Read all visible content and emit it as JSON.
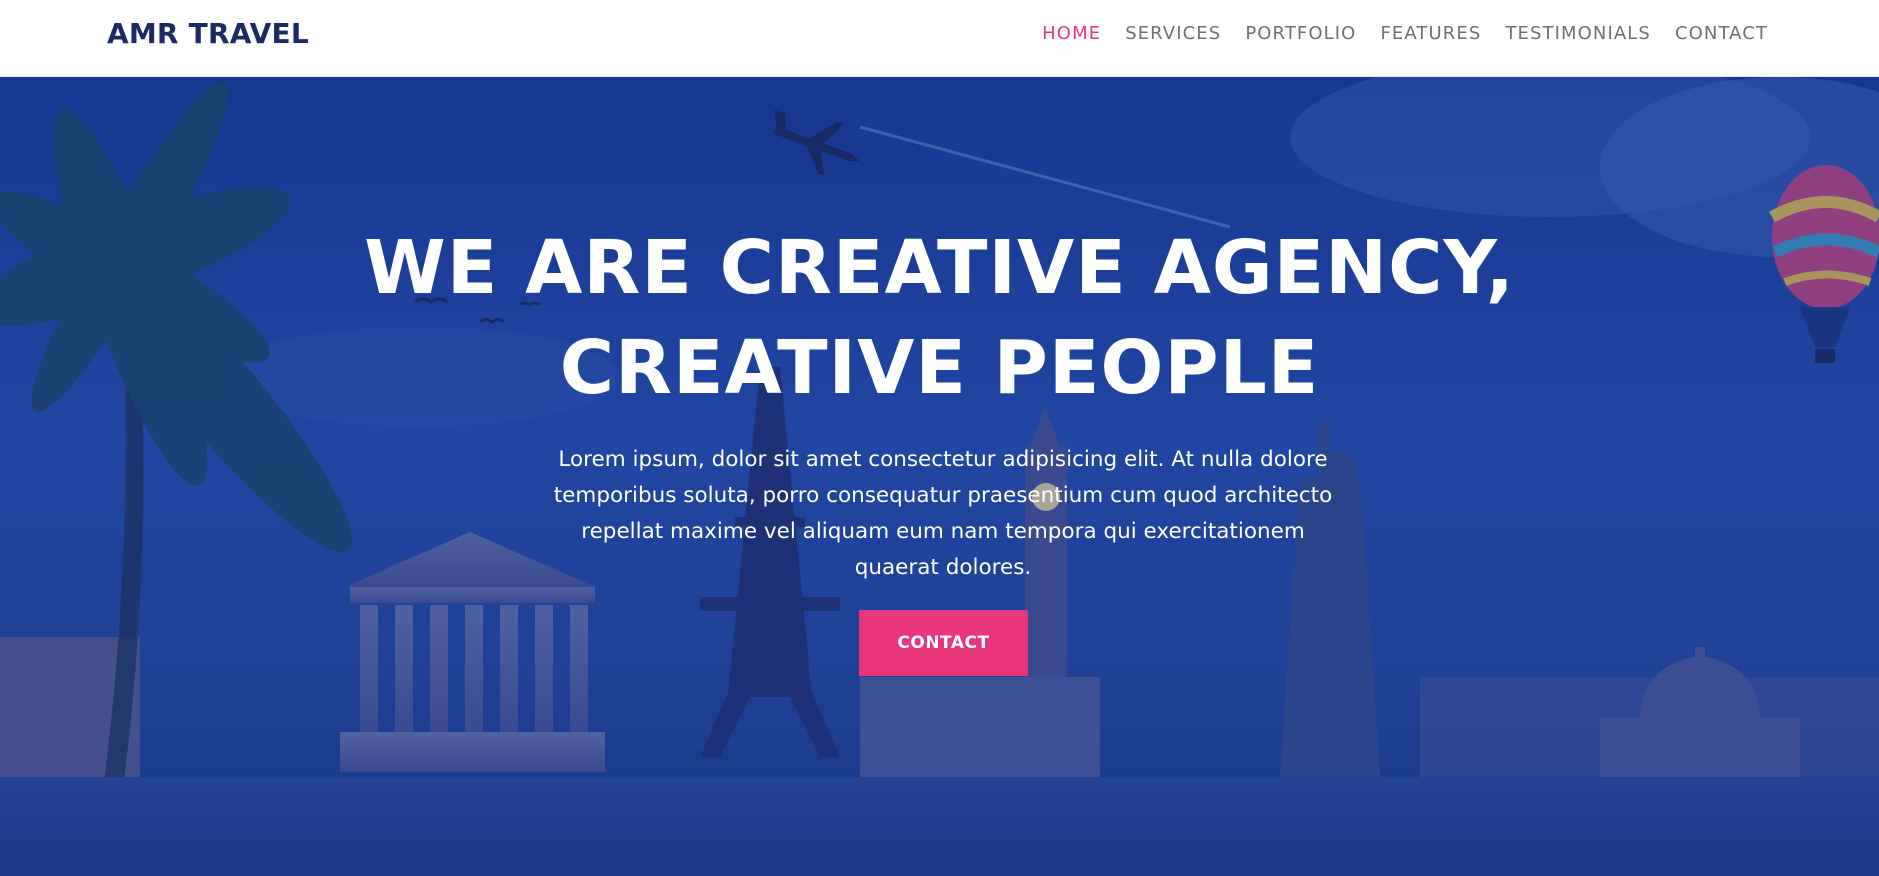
{
  "navbar": {
    "brand": "AMR TRAVEL",
    "links": [
      {
        "label": "HOME",
        "active": true
      },
      {
        "label": "SERVICES",
        "active": false
      },
      {
        "label": "PORTFOLIO",
        "active": false
      },
      {
        "label": "FEATURES",
        "active": false
      },
      {
        "label": "TESTIMONIALS",
        "active": false
      },
      {
        "label": "CONTACT",
        "active": false
      }
    ]
  },
  "hero": {
    "title_line1": "WE ARE CREATIVE AGENCY,",
    "title_line2": "CREATIVE PEOPLE",
    "text": "Lorem ipsum, dolor sit amet consectetur adipisicing elit. At nulla dolore temporibus soluta, porro consequatur praesentium cum quod architecto repellat maxime vel aliquam eum nam tempora qui exercitationem quaerat dolores.",
    "button_label": "CONTACT"
  },
  "colors": {
    "brand": "#1b2a63",
    "accent": "#e7367c",
    "nav_text": "#6e6e78",
    "hero_overlay": "#1e45a0"
  },
  "icons": {
    "background": "world-landmarks-illustration",
    "plane": "airplane-icon",
    "balloon": "hot-air-balloon-icon"
  }
}
